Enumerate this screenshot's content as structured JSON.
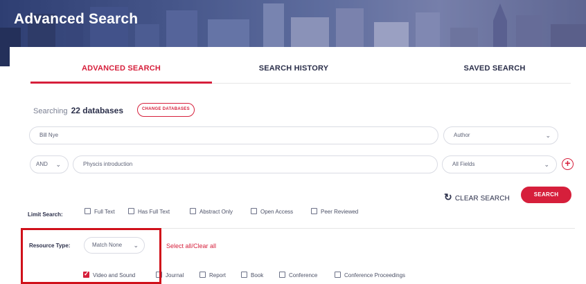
{
  "banner": {
    "title": "Advanced Search"
  },
  "tabs": [
    {
      "label": "ADVANCED SEARCH",
      "active": true
    },
    {
      "label": "SEARCH HISTORY",
      "active": false
    },
    {
      "label": "SAVED SEARCH",
      "active": false
    }
  ],
  "searching": {
    "prefix": "Searching",
    "count_text": "22 databases",
    "change_label": "CHANGE DATABASES"
  },
  "rows": [
    {
      "operator": null,
      "query": "Bill Nye",
      "field": "Author"
    },
    {
      "operator": "AND",
      "query": "Physcis introduction",
      "field": "All Fields"
    }
  ],
  "actions": {
    "clear_label": "CLEAR SEARCH",
    "search_label": "SEARCH",
    "add_icon": "plus-circle-icon",
    "clear_icon": "refresh-icon"
  },
  "limit": {
    "label": "Limit Search:",
    "options": [
      {
        "label": "Full Text",
        "checked": false
      },
      {
        "label": "Has Full Text",
        "checked": false
      },
      {
        "label": "Abstract Only",
        "checked": false
      },
      {
        "label": "Open Access",
        "checked": false
      },
      {
        "label": "Peer Reviewed",
        "checked": false
      }
    ]
  },
  "resource_type": {
    "label": "Resource Type:",
    "match_value": "Match None",
    "select_all_label": "Select all/Clear all",
    "options": [
      {
        "label": "Video and Sound",
        "checked": true
      },
      {
        "label": "Journal",
        "checked": false
      },
      {
        "label": "Report",
        "checked": false
      },
      {
        "label": "Book",
        "checked": false
      },
      {
        "label": "Conference",
        "checked": false
      },
      {
        "label": "Conference Proceedings",
        "checked": false
      }
    ]
  },
  "colors": {
    "accent": "#d61f3b",
    "text": "#2b2f4a",
    "highlight": "#d0101a"
  }
}
